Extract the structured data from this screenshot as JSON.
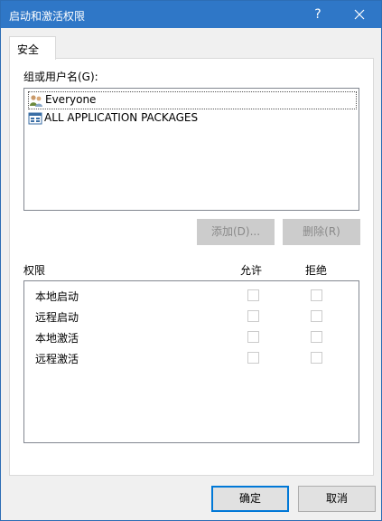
{
  "window": {
    "title": "启动和激活权限",
    "help": "?",
    "close": "✕"
  },
  "tabs": [
    {
      "label": "安全"
    }
  ],
  "group_label": "组或用户名(G):",
  "users": [
    {
      "name": "Everyone",
      "icon": "users-group-icon",
      "selected": true
    },
    {
      "name": "ALL APPLICATION PACKAGES",
      "icon": "app-packages-icon",
      "selected": false
    }
  ],
  "buttons": {
    "add": "添加(D)...",
    "remove": "删除(R)",
    "ok": "确定",
    "cancel": "取消"
  },
  "permissions": {
    "header": "权限",
    "allow": "允许",
    "deny": "拒绝",
    "rows": [
      {
        "label": "本地启动",
        "allow": false,
        "deny": false
      },
      {
        "label": "远程启动",
        "allow": false,
        "deny": false
      },
      {
        "label": "本地激活",
        "allow": false,
        "deny": false
      },
      {
        "label": "远程激活",
        "allow": false,
        "deny": false
      }
    ]
  },
  "colors": {
    "titlebar": "#2f77c7",
    "focus": "#0078d7"
  }
}
